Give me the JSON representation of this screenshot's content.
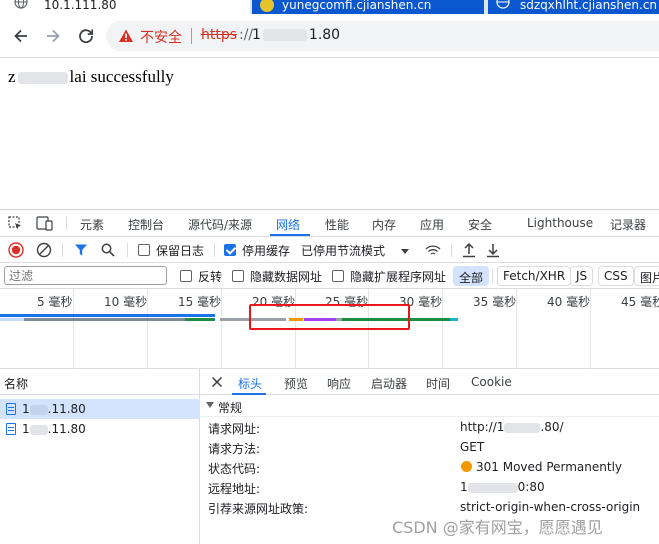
{
  "browser": {
    "tabs": [
      {
        "title": "10.1.111.80",
        "active": true
      },
      {
        "title": "yunegcomfi.cjianshen.cn",
        "active": false
      },
      {
        "title": "sdzqxhlht.cjianshen.cn",
        "active": false
      }
    ],
    "omnibox": {
      "security_label": "不安全",
      "url_scheme": "https",
      "url_sep": "://",
      "url_host_prefix": "1",
      "url_host_suffix": "1.80"
    }
  },
  "page": {
    "message_prefix": "z",
    "message_fragment": "lai",
    "message_suffix": "successfully"
  },
  "devtools": {
    "tabs": [
      "元素",
      "控制台",
      "源代码/来源",
      "网络",
      "性能",
      "内存",
      "应用",
      "安全",
      "Lighthouse",
      "记录器"
    ],
    "active_tab": "网络",
    "network_toolbar": {
      "preserve_log": {
        "label": "保留日志",
        "checked": false
      },
      "disable_cache": {
        "label": "停用缓存",
        "checked": true
      },
      "throttling": "已停用节流模式"
    },
    "filter": {
      "placeholder": "过滤",
      "invert": {
        "label": "反转",
        "checked": false
      },
      "hide_data_urls": {
        "label": "隐藏数据网址",
        "checked": false
      },
      "hide_extension_urls": {
        "label": "隐藏扩展程序网址",
        "checked": false
      },
      "types": [
        "全部",
        "Fetch/XHR",
        "JS",
        "CSS",
        "图片"
      ],
      "active_type": "全部"
    },
    "timeline": {
      "ticks": [
        "5 毫秒",
        "10 毫秒",
        "15 毫秒",
        "20 毫秒",
        "25 毫秒",
        "30 毫秒",
        "35 毫秒",
        "40 毫秒",
        "45 毫秒"
      ]
    },
    "request_list": {
      "column_header": "名称",
      "rows": [
        {
          "prefix": "1",
          "suffix": ".11.80",
          "selected": true
        },
        {
          "prefix": "1",
          "suffix": ".11.80",
          "selected": false
        }
      ]
    },
    "detail": {
      "tabs": [
        "标头",
        "预览",
        "响应",
        "启动器",
        "时间",
        "Cookie"
      ],
      "active_tab": "标头",
      "section_title": "常规",
      "general": {
        "request_url": {
          "key": "请求网址:",
          "value_prefix": "http://1",
          "value_suffix": ".80/"
        },
        "request_method": {
          "key": "请求方法:",
          "value": "GET"
        },
        "status_code": {
          "key": "状态代码:",
          "value": "301 Moved Permanently",
          "status_color": "#f29900"
        },
        "remote_address": {
          "key": "远程地址:",
          "value_prefix": "1",
          "value_suffix": "0:80"
        },
        "referrer_policy": {
          "key": "引荐来源网址政策:",
          "value": "strict-origin-when-cross-origin"
        }
      }
    }
  },
  "watermark": "CSDN @家有网宝，愿愿遇见",
  "colors": {
    "accent": "#1a73e8",
    "insecure": "#d93025",
    "highlight": "#e8171a"
  }
}
